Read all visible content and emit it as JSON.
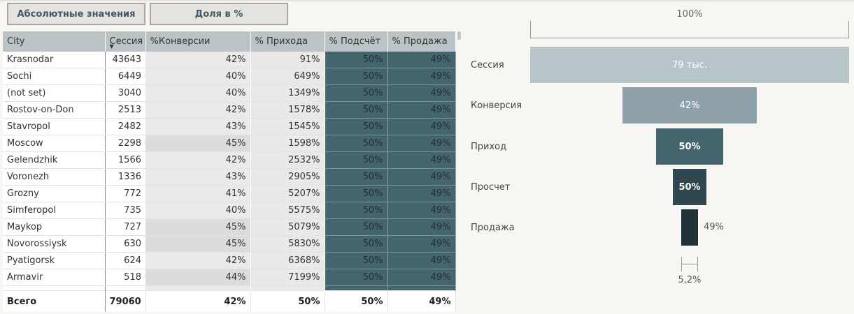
{
  "toggle": {
    "absolute_label": "Абсолютные значения",
    "share_label": "Доля в %"
  },
  "table": {
    "headers": [
      "City",
      "Сессия",
      "%Конверсии",
      "% Прихода",
      "% Подсчёт",
      "% Продажа"
    ],
    "rows": [
      [
        "Krasnodar",
        "43643",
        "42%",
        "91%",
        "50%",
        "49%"
      ],
      [
        "Sochi",
        "6449",
        "40%",
        "649%",
        "50%",
        "49%"
      ],
      [
        "(not set)",
        "3040",
        "40%",
        "1349%",
        "50%",
        "49%"
      ],
      [
        "Rostov-on-Don",
        "2513",
        "42%",
        "1578%",
        "50%",
        "49%"
      ],
      [
        "Stavropol",
        "2482",
        "43%",
        "1545%",
        "50%",
        "49%"
      ],
      [
        "Moscow",
        "2298",
        "45%",
        "1598%",
        "50%",
        "49%"
      ],
      [
        "Gelendzhik",
        "1566",
        "42%",
        "2532%",
        "50%",
        "49%"
      ],
      [
        "Voronezh",
        "1336",
        "43%",
        "2905%",
        "50%",
        "49%"
      ],
      [
        "Grozny",
        "772",
        "41%",
        "5207%",
        "50%",
        "49%"
      ],
      [
        "Simferopol",
        "735",
        "40%",
        "5575%",
        "50%",
        "49%"
      ],
      [
        "Maykop",
        "727",
        "45%",
        "5079%",
        "50%",
        "49%"
      ],
      [
        "Novorossiysk",
        "630",
        "45%",
        "5830%",
        "50%",
        "49%"
      ],
      [
        "Pyatigorsk",
        "624",
        "42%",
        "6368%",
        "50%",
        "49%"
      ],
      [
        "Armavir",
        "518",
        "44%",
        "7199%",
        "50%",
        "49%"
      ]
    ],
    "total": [
      "Всего",
      "79060",
      "42%",
      "50%",
      "50%",
      "49%"
    ],
    "colors": {
      "header_bg": "#bac4c7",
      "conv_light": "#eaeaea",
      "conv_dark": "#dcdcdc",
      "prihod_bg": "#e9e9e9",
      "dark_cell": "#44646e"
    }
  },
  "funnel": {
    "scale_label": "100%",
    "stages": [
      {
        "name": "Сессия",
        "value_label": "79 тыс.",
        "share": 1.0,
        "color": "#b7c4c8",
        "label_inside": true
      },
      {
        "name": "Конверсия",
        "value_label": "42%",
        "share": 0.42,
        "color": "#8fa1a8",
        "label_inside": true
      },
      {
        "name": "Приход",
        "value_label": "50%",
        "share": 0.21,
        "color": "#44646e",
        "label_inside": true
      },
      {
        "name": "Просчет",
        "value_label": "50%",
        "share": 0.105,
        "color": "#2f474e",
        "label_inside": true
      },
      {
        "name": "Продажа",
        "value_label": "49%",
        "share": 0.052,
        "color": "#1f3338",
        "label_inside": false
      }
    ],
    "final_width_label": "5,2%"
  }
}
